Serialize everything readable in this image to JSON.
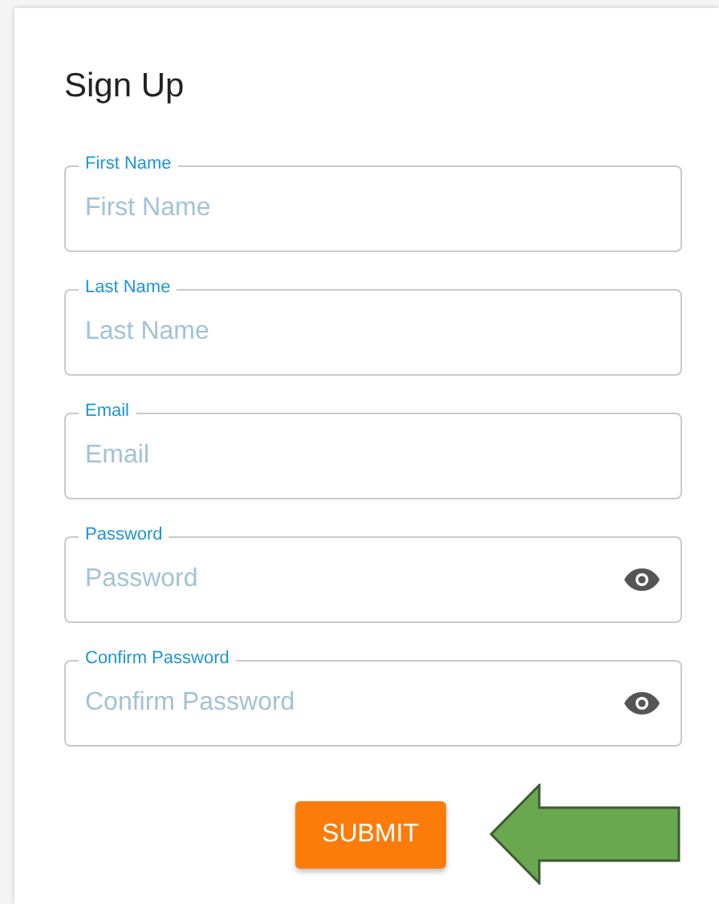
{
  "title": "Sign Up",
  "fields": [
    {
      "kind": "text",
      "label": "First Name",
      "placeholder": "First Name"
    },
    {
      "kind": "text",
      "label": "Last Name",
      "placeholder": "Last Name"
    },
    {
      "kind": "text",
      "label": "Email",
      "placeholder": "Email"
    },
    {
      "kind": "password",
      "label": "Password",
      "placeholder": "Password"
    },
    {
      "kind": "password",
      "label": "Confirm Password",
      "placeholder": "Confirm Password"
    }
  ],
  "submit": "SUBMIT",
  "annotation": {
    "kind": "arrow"
  }
}
